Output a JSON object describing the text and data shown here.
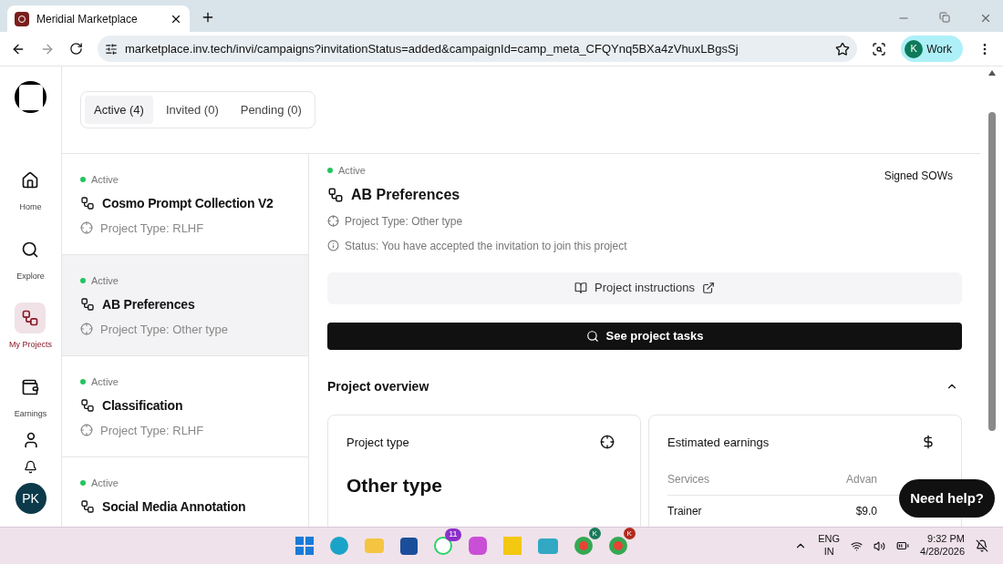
{
  "browser": {
    "tab_title": "Meridial Marketplace",
    "url": "marketplace.inv.tech/invi/campaigns?invitationStatus=added&campaignId=camp_meta_CFQYnq5BXa4zVhuxLBgsSj",
    "profile_initial": "K",
    "profile_label": "Work"
  },
  "sidebar": {
    "items": [
      {
        "label": "Home",
        "kind": "home",
        "selected": false
      },
      {
        "label": "Explore",
        "kind": "explore",
        "selected": false
      },
      {
        "label": "My Projects",
        "kind": "projects",
        "selected": true
      },
      {
        "label": "Earnings",
        "kind": "earnings",
        "selected": false
      }
    ],
    "avatar": "PK"
  },
  "filter_tabs": [
    {
      "label": "Active (4)",
      "selected": true
    },
    {
      "label": "Invited (0)",
      "selected": false
    },
    {
      "label": "Pending (0)",
      "selected": false
    }
  ],
  "projects": [
    {
      "status": "Active",
      "color": "#22c55e",
      "name": "Cosmo Prompt Collection V2",
      "type": "Project Type: RLHF",
      "selected": false
    },
    {
      "status": "Active",
      "color": "#22c55e",
      "name": "AB Preferences",
      "type": "Project Type: Other type",
      "selected": true
    },
    {
      "status": "Active",
      "color": "#22c55e",
      "name": "Classification",
      "type": "Project Type: RLHF",
      "selected": false
    },
    {
      "status": "Active",
      "color": "#22c55e",
      "name": "Social Media Annotation",
      "selected": false
    }
  ],
  "detail": {
    "status": "Active",
    "title": "AB Preferences",
    "type": "Project Type: Other type",
    "status_text": "Status: You have accepted the invitation to join this project",
    "signed_sows": "Signed SOWs",
    "instructions_button": "Project instructions",
    "tasks_button": "See project tasks",
    "overview": {
      "title": "Project overview",
      "expanded": true,
      "project_type_card": {
        "title": "Project type",
        "value": "Other type"
      },
      "earnings_card": {
        "title": "Estimated earnings",
        "columns": [
          "Services",
          "Advan"
        ],
        "rows": [
          [
            "Trainer",
            "$9.0"
          ]
        ]
      }
    }
  },
  "help_button": "Need help?",
  "taskbar": {
    "whatsapp_badge": "11",
    "chrome_badges": [
      "K",
      "K"
    ],
    "language": "ENG",
    "region": "IN",
    "time": "9:32 PM",
    "date": "4/28/2026"
  }
}
